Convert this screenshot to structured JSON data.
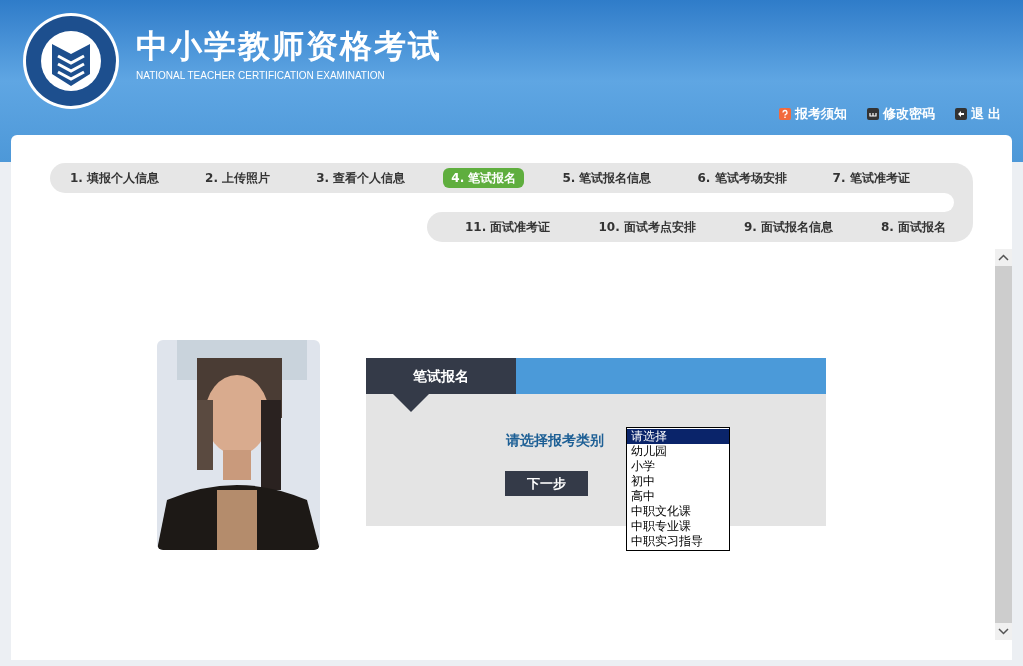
{
  "header": {
    "title": "中小学教师资格考试",
    "subtitle": "NATIONAL TEACHER CERTIFICATION EXAMINATION",
    "links": [
      {
        "kind": "notice",
        "label": "报考须知"
      },
      {
        "kind": "password",
        "label": "修改密码"
      },
      {
        "kind": "logout",
        "label": "退 出"
      }
    ]
  },
  "steps": {
    "row_1": [
      {
        "label": "1. 填报个人信息",
        "selected": false
      },
      {
        "label": "2. 上传照片",
        "selected": false
      },
      {
        "label": "3. 查看个人信息",
        "selected": false
      },
      {
        "label": "4. 笔试报名",
        "selected": true
      },
      {
        "label": "5. 笔试报名信息",
        "selected": false
      },
      {
        "label": "6. 笔试考场安排",
        "selected": false
      },
      {
        "label": "7. 笔试准考证",
        "selected": false
      }
    ],
    "row_2": [
      {
        "label": "11. 面试准考证",
        "selected": false
      },
      {
        "label": "10. 面试考点安排",
        "selected": false
      },
      {
        "label": "9. 面试报名信息",
        "selected": false
      },
      {
        "label": "8. 面试报名",
        "selected": false
      }
    ]
  },
  "panel": {
    "title": "笔试报名",
    "field_label": "请选择报考类别",
    "next_button": "下一步",
    "options": [
      {
        "label": "请选择",
        "selected": true
      },
      {
        "label": "幼儿园",
        "selected": false
      },
      {
        "label": "小学",
        "selected": false
      },
      {
        "label": "初中",
        "selected": false
      },
      {
        "label": "高中",
        "selected": false
      },
      {
        "label": "中职文化课",
        "selected": false
      },
      {
        "label": "中职专业课",
        "selected": false
      },
      {
        "label": "中职实习指导",
        "selected": false
      }
    ]
  }
}
